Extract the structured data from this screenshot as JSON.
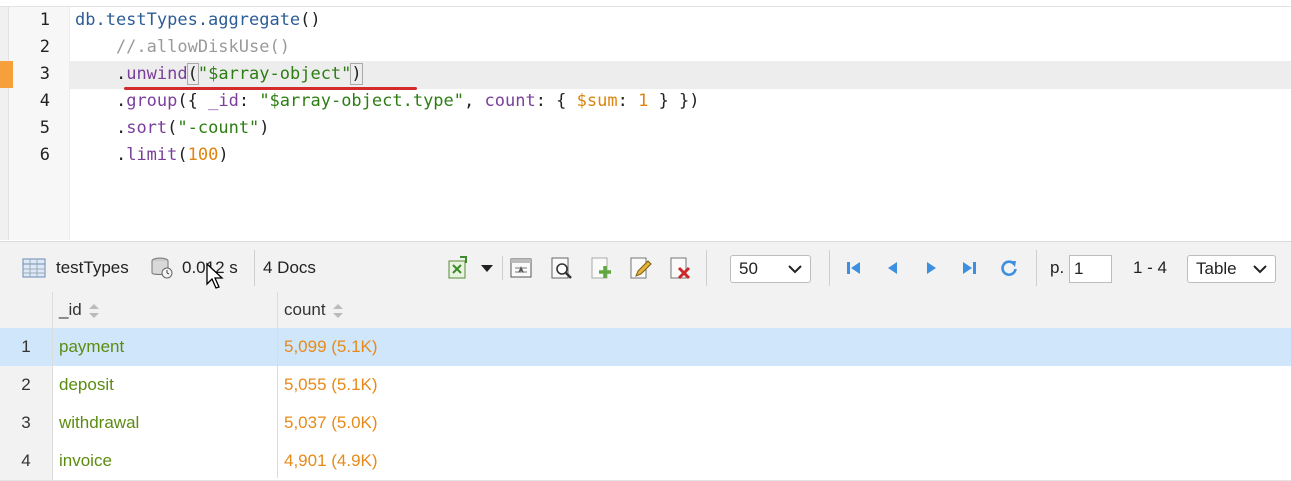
{
  "editor": {
    "line_numbers": [
      "1",
      "2",
      "3",
      "4",
      "5",
      "6"
    ],
    "lines": {
      "l1": {
        "a": "db.testTypes.aggregate",
        "b": "()"
      },
      "l2": {
        "a": "    //.allowDiskUse()"
      },
      "l3": {
        "indent": "    ",
        "dot": ".",
        "fn": "unwind",
        "open": "(",
        "str": "\"$array-object\"",
        "close": ")"
      },
      "l4": {
        "indent": "    ",
        "dot": ".",
        "fn": "group",
        "p1": "({ ",
        "k1": "_id",
        "p2": ": ",
        "s1": "\"$array-object.type\"",
        "p3": ", ",
        "k2": "count",
        "p4": ": { ",
        "k3": "$sum",
        "p5": ": ",
        "n1": "1",
        "p6": " } })"
      },
      "l5": {
        "indent": "    ",
        "dot": ".",
        "fn": "sort",
        "p1": "(",
        "s1": "\"-count\"",
        "p2": ")"
      },
      "l6": {
        "indent": "    ",
        "dot": ".",
        "fn": "limit",
        "p1": "(",
        "n1": "100",
        "p2": ")"
      }
    }
  },
  "toolbar": {
    "collection": "testTypes",
    "time": "0.012 s",
    "docs": "4 Docs",
    "page_size": "50",
    "page_label": "p.",
    "page_value": "1",
    "range": "1 - 4",
    "view_mode": "Table",
    "icons": [
      "table-icon",
      "database-time-icon",
      "export-icon",
      "dropdown-arrow-icon",
      "view-document-icon",
      "find-icon",
      "add-document-icon",
      "edit-document-icon",
      "delete-document-icon",
      "first-page-icon",
      "prev-page-icon",
      "next-page-icon",
      "last-page-icon",
      "refresh-icon"
    ]
  },
  "table": {
    "columns": [
      "_id",
      "count"
    ],
    "rows": [
      {
        "n": "1",
        "id": "payment",
        "count": "5,099 (5.1K)"
      },
      {
        "n": "2",
        "id": "deposit",
        "count": "5,055 (5.1K)"
      },
      {
        "n": "3",
        "id": "withdrawal",
        "count": "5,037 (5.0K)"
      },
      {
        "n": "4",
        "id": "invoice",
        "count": "4,901 (4.9K)"
      }
    ]
  },
  "colors": {
    "accent": "#f5a03a",
    "selection": "#cfe6fb",
    "id_text": "#5b8c10",
    "count_text": "#e88a1a",
    "error_underline": "#d42a2a"
  }
}
